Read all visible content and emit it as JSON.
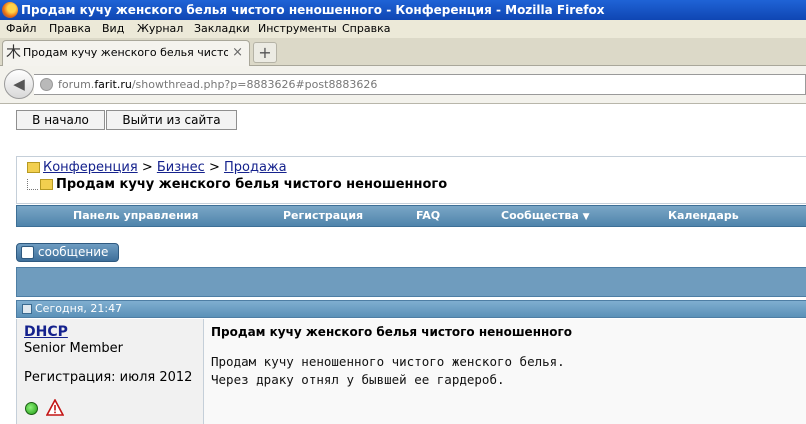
{
  "window": {
    "title": "Продам кучу женского белья чистого неношенного - Конференция - Mozilla Firefox"
  },
  "menu": [
    "Файл",
    "Правка",
    "Вид",
    "Журнал",
    "Закладки",
    "Инструменты",
    "Справка"
  ],
  "tab": {
    "label": "Продам кучу женского белья чистого неношенного ...",
    "close": "×",
    "new_tab": "+"
  },
  "address": {
    "domain_prefix": "forum.",
    "domain": "farit.ru",
    "path": "/showthread.php?p=8883626#post8883626"
  },
  "page": {
    "btn_home": "В начало",
    "btn_logout": "Выйти из сайта",
    "breadcrumb": [
      "Конференция",
      "Бизнес",
      "Продажа"
    ],
    "breadcrumb_sep": ">",
    "thread_title": "Продам кучу женского белья чистого неношенного",
    "nav": [
      "Панель управления",
      "Регистрация",
      "FAQ",
      "Сообщества",
      "Календарь"
    ],
    "nav_dropdown_arrow": "▼",
    "reply_button": "сообщение",
    "post": {
      "date": "Сегодня, 21:47",
      "username": "DHCP",
      "user_title": "Senior Member",
      "join": "Регистрация: июля 2012",
      "title": "Продам кучу женского белья чистого неношенного",
      "lines": [
        "Продам кучу неношенного чистого женского белья.",
        "Через драку отнял у бывшей ее гардероб."
      ]
    }
  }
}
